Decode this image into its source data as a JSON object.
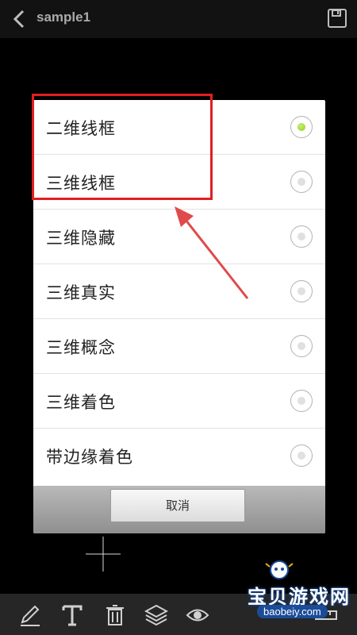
{
  "header": {
    "title": "sample1",
    "back_icon": "chevron-left-icon",
    "save_icon": "floppy-disk-icon"
  },
  "dialog": {
    "options": [
      {
        "label": "二维线框",
        "selected": true
      },
      {
        "label": "三维线框",
        "selected": false
      },
      {
        "label": "三维隐藏",
        "selected": false
      },
      {
        "label": "三维真实",
        "selected": false
      },
      {
        "label": "三维概念",
        "selected": false
      },
      {
        "label": "三维着色",
        "selected": false
      },
      {
        "label": "带边缘着色",
        "selected": false
      }
    ],
    "cancel_label": "取消"
  },
  "toolbar": {
    "icons": [
      "pencil-icon",
      "text-icon",
      "trash-icon",
      "layers-icon",
      "eye-icon",
      "ruler-icon"
    ]
  },
  "watermark": {
    "text": "宝贝游戏网",
    "url": "baobeiy.com"
  },
  "colors": {
    "background": "#000000",
    "annotation_red": "#e02020",
    "radio_selected": "#8fcf28",
    "dialog_footer": "#a6a6a6"
  }
}
